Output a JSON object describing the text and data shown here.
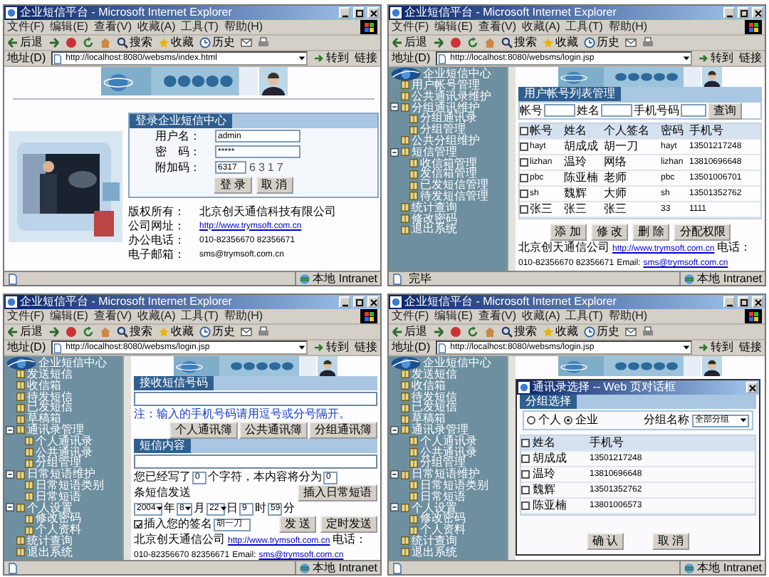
{
  "windows": [
    {
      "title": "企业短信平台 - Microsoft Internet Explorer",
      "menu": [
        "文件(F)",
        "编辑(E)",
        "查看(V)",
        "收藏(A)",
        "工具(T)",
        "帮助(H)"
      ],
      "toolbar": [
        {
          "kind": "back",
          "label": "后退"
        },
        {
          "kind": "search",
          "label": "搜索"
        },
        {
          "kind": "favorites",
          "label": "收藏"
        },
        {
          "kind": "history",
          "label": "历史"
        }
      ],
      "address_label": "地址(D)",
      "url": "http://localhost:8080/websms/index.html",
      "go": "转到",
      "links": "链接",
      "zone": "本地 Intranet",
      "page": {
        "kind": "login",
        "login": {
          "title": "登录企业短信中心",
          "fields": [
            {
              "label": "用户名：",
              "value": "admin"
            },
            {
              "label": "密　码：",
              "value": "*****"
            }
          ],
          "code_label": "附加码：",
          "code_value": "6317",
          "code": "6317",
          "buttons": [
            "登 录",
            "取 消"
          ]
        },
        "contacts": [
          {
            "kind": "text",
            "label": "版权所有：",
            "value": "北京创天通信科技有限公司"
          },
          {
            "kind": "link",
            "label": "公司网址：",
            "value": "http://www.trymsoft.com.cn"
          },
          {
            "kind": "text",
            "label": "办公电话：",
            "value": "010-82356670 82356671"
          },
          {
            "kind": "text",
            "label": "电子邮箱：",
            "value": "sms@trymsoft.com.cn"
          }
        ]
      }
    },
    {
      "title": "企业短信平台 - Microsoft Internet Explorer",
      "menu": [
        "文件(F)",
        "编辑(E)",
        "查看(V)",
        "收藏(A)",
        "工具(T)",
        "帮助(H)"
      ],
      "toolbar": [
        {
          "kind": "back",
          "label": "后退"
        },
        {
          "kind": "search",
          "label": "搜索"
        },
        {
          "kind": "favorites",
          "label": "收藏"
        },
        {
          "kind": "history",
          "label": "历史"
        }
      ],
      "address_label": "地址(D)",
      "url": "http://localhost:8080/websms/login.jsp",
      "go": "转到",
      "links": "链接",
      "status": "完毕",
      "zone": "本地 Intranet",
      "page": {
        "kind": "accounts",
        "sidebar": {
          "subtitle": "企业短信中心",
          "tree": [
            {
              "label": "用户帐号管理"
            },
            {
              "label": "公共通讯录维护"
            },
            {
              "label": "分组通讯维护",
              "expanded": true,
              "children": [
                {
                  "label": "分组通讯录"
                },
                {
                  "label": "分组管理"
                }
              ]
            },
            {
              "label": "公共分组维护"
            },
            {
              "label": "短信管理",
              "expanded": true,
              "children": [
                {
                  "label": "收信箱管理"
                },
                {
                  "label": "发信箱管理"
                },
                {
                  "label": "已发短信管理"
                },
                {
                  "label": "待发短信管理"
                }
              ]
            },
            {
              "label": "统计查询"
            },
            {
              "label": "修改密码"
            },
            {
              "label": "退出系统"
            }
          ]
        },
        "panel_title": "用户帐号列表管理",
        "search": [
          "帐号",
          "姓名",
          "手机号码"
        ],
        "search_button": "查询",
        "table": {
          "all_checked": false,
          "columns": [
            "帐号",
            "姓名",
            "个人签名",
            "密码",
            "手机号"
          ],
          "rows": [
            {
              "checked": false,
              "cells": [
                "hayt",
                "胡成成",
                "胡一刀",
                "hayt",
                "13501217248"
              ]
            },
            {
              "checked": false,
              "cells": [
                "lizhan",
                "温玲",
                "网络",
                "lizhan",
                "13810696648"
              ]
            },
            {
              "checked": false,
              "cells": [
                "pbc",
                "陈亚楠",
                "老师",
                "pbc",
                "13501006701"
              ]
            },
            {
              "checked": false,
              "cells": [
                "sh",
                "魏辉",
                "大师",
                "sh",
                "13501352762"
              ]
            },
            {
              "checked": false,
              "cells": [
                "张三",
                "张三",
                "张三",
                "33",
                "1111"
              ]
            }
          ]
        },
        "buttons": [
          "添 加",
          "修 改",
          "删 除",
          "分配权限"
        ],
        "footer": {
          "company": "北京创天通信公司",
          "url": "http://www.trymsoft.com.cn",
          "phone_label": "电话：",
          "phone": "010-82356670 82356671",
          "email_label": "Email:",
          "email": "sms@trymsoft.com.cn"
        }
      }
    },
    {
      "title": "企业短信平台 - Microsoft Internet Explorer",
      "menu": [
        "文件(F)",
        "编辑(E)",
        "查看(V)",
        "收藏(A)",
        "工具(T)",
        "帮助(H)"
      ],
      "toolbar": [
        {
          "kind": "back",
          "label": "后退"
        },
        {
          "kind": "search",
          "label": "搜索"
        },
        {
          "kind": "favorites",
          "label": "收藏"
        },
        {
          "kind": "history",
          "label": "历史"
        }
      ],
      "address_label": "地址(D)",
      "url": "http://localhost:8080/websms/login.jsp",
      "go": "转到",
      "links": "链接",
      "zone": "本地 Intranet",
      "page": {
        "kind": "send",
        "sidebar": {
          "subtitle": "企业短信中心",
          "tree": [
            {
              "label": "发送短信"
            },
            {
              "label": "收信箱"
            },
            {
              "label": "待发短信"
            },
            {
              "label": "已发短信"
            },
            {
              "label": "草稿箱"
            },
            {
              "label": "通讯录管理",
              "expanded": true,
              "children": [
                {
                  "label": "个人通讯录"
                },
                {
                  "label": "公共通讯录"
                },
                {
                  "label": "分组管理"
                }
              ]
            },
            {
              "label": "日常短语维护",
              "expanded": true,
              "children": [
                {
                  "label": "日常短语类别"
                },
                {
                  "label": "日常短语"
                }
              ]
            },
            {
              "label": "个人设置",
              "expanded": true,
              "children": [
                {
                  "label": "修改密码"
                },
                {
                  "label": "个人资料"
                }
              ]
            },
            {
              "label": "统计查询"
            },
            {
              "label": "退出系统"
            }
          ]
        },
        "receiver_title": "接收短信号码",
        "note": "注：输入的手机号码请用逗号或分号隔开。",
        "book_buttons": [
          "个人通讯簿",
          "公共通讯簿",
          "分组通讯簿"
        ],
        "content_title": "短信内容",
        "written_label": "您已经写了",
        "written": "0",
        "parts_label": "个字符，本内容将分为",
        "parts": "0",
        "parts_suffix": "条短信发送",
        "phrase_button": "插入日常短语",
        "schedule": [
          {
            "value": "2004",
            "unit": "年"
          },
          {
            "value": "8",
            "unit": "月"
          },
          {
            "value": "22",
            "unit": "日"
          },
          {
            "value": "9",
            "unit": "时",
            "kind": "field"
          },
          {
            "value": "59",
            "unit": "分",
            "kind": "field"
          }
        ],
        "signature": {
          "checked": true,
          "label": "插入您的签名",
          "value": "胡一刀"
        },
        "buttons": [
          "发 送",
          "定时发送"
        ],
        "footer": {
          "company": "北京创天通信公司",
          "url": "http://www.trymsoft.com.cn",
          "phone_label": "电话：",
          "phone": "010-82356670 82356671",
          "email_label": "Email:",
          "email": "sms@trymsoft.com.cn"
        }
      }
    },
    {
      "title": "企业短信平台 - Microsoft Internet Explorer",
      "menu": [
        "文件(F)",
        "编辑(E)",
        "查看(V)",
        "收藏(A)",
        "工具(T)",
        "帮助(H)"
      ],
      "toolbar": [
        {
          "kind": "back",
          "label": "后退"
        },
        {
          "kind": "search",
          "label": "搜索"
        },
        {
          "kind": "favorites",
          "label": "收藏"
        },
        {
          "kind": "history",
          "label": "历史"
        }
      ],
      "address_label": "地址(D)",
      "url": "http://localhost:8080/websms/login.jsp",
      "go": "转到",
      "links": "链接",
      "zone": "本地 Intranet",
      "page": {
        "kind": "send_dialog",
        "sidebar": {
          "subtitle": "企业短信中心",
          "tree": [
            {
              "label": "发送短信"
            },
            {
              "label": "收信箱"
            },
            {
              "label": "待发短信"
            },
            {
              "label": "已发短信"
            },
            {
              "label": "草稿箱"
            },
            {
              "label": "通讯录管理",
              "expanded": true,
              "children": [
                {
                  "label": "个人通讯录"
                },
                {
                  "label": "公共通讯录"
                },
                {
                  "label": "分组管理"
                }
              ]
            },
            {
              "label": "日常短语维护",
              "expanded": true,
              "children": [
                {
                  "label": "日常短语类别"
                },
                {
                  "label": "日常短语"
                }
              ]
            },
            {
              "label": "个人设置",
              "expanded": true,
              "children": [
                {
                  "label": "修改密码"
                },
                {
                  "label": "个人资料"
                }
              ]
            },
            {
              "label": "统计查询"
            },
            {
              "label": "退出系统"
            }
          ]
        },
        "dialog": {
          "title": "通讯录选择 -- Web 页对话框",
          "panel_title": "分组选择",
          "scopes": [
            {
              "label": "个人",
              "selected": false
            },
            {
              "label": "企业",
              "selected": true
            }
          ],
          "group_label": "分组名称",
          "group_value": "全部分组",
          "table": {
            "all_checked": false,
            "columns": [
              "姓名",
              "手机号"
            ],
            "rows": [
              {
                "checked": false,
                "cells": [
                  "胡成成",
                  "13501217248"
                ]
              },
              {
                "checked": false,
                "cells": [
                  "温玲",
                  "13810696648"
                ]
              },
              {
                "checked": false,
                "cells": [
                  "魏辉",
                  "13501352762"
                ]
              },
              {
                "checked": false,
                "cells": [
                  "陈亚楠",
                  "13801006573"
                ]
              }
            ]
          },
          "buttons": [
            "确 认",
            "取 消"
          ]
        }
      }
    }
  ]
}
